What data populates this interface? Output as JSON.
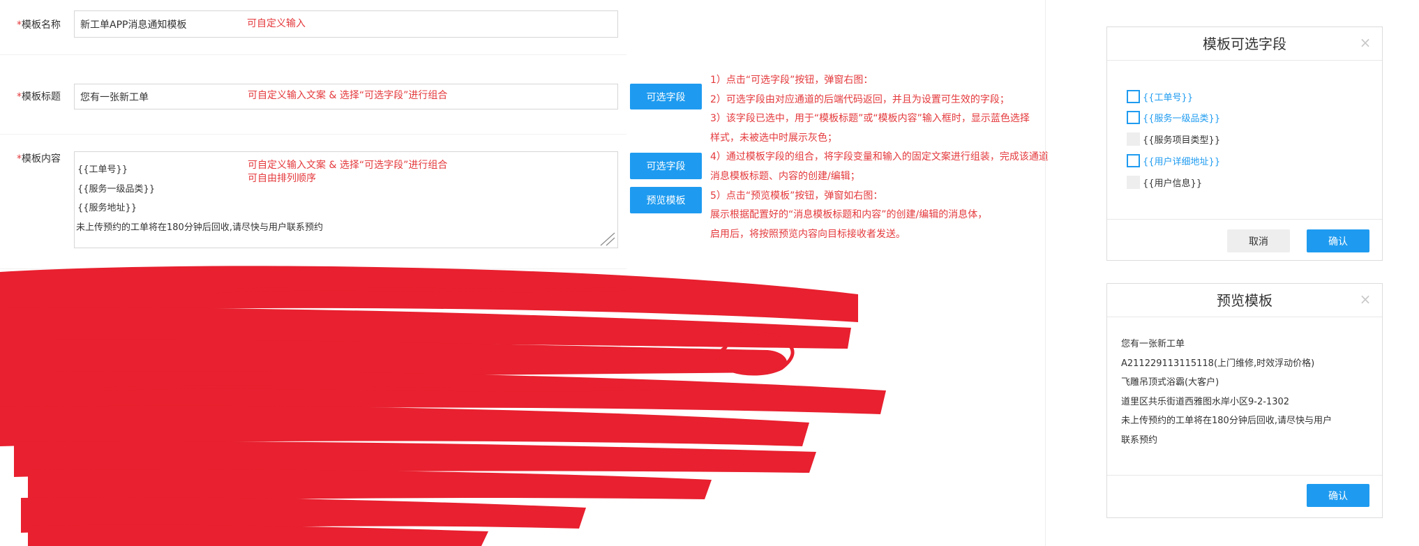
{
  "form": {
    "name": {
      "star": "*",
      "label": "模板名称",
      "value": "新工单APP消息通知模板",
      "note": "可自定义输入"
    },
    "title": {
      "star": "*",
      "label": "模板标题",
      "value": "您有一张新工单",
      "note": "可自定义输入文案 & 选择“可选字段”进行组合",
      "button": "可选字段"
    },
    "content": {
      "star": "*",
      "label": "模板内容",
      "lines": [
        "{{工单号}}",
        "{{服务一级品类}}",
        "{{服务地址}}",
        "未上传预约的工单将在180分钟后回收,请尽快与用户联系预约"
      ],
      "note_lines": [
        "可自定义输入文案 & 选择“可选字段”进行组合",
        "可自由排列顺序"
      ],
      "button": "可选字段",
      "preview_button": "预览模板"
    }
  },
  "notes": [
    "1）点击“可选字段”按钮，弹窗右图：",
    "2）可选字段由对应通道的后端代码返回，并且为设置可生效的字段；",
    "3）该字段已选中，用于“模板标题”或“模板内容”输入框时，显示蓝色选择",
    "样式，未被选中时展示灰色；",
    "4）通过模板字段的组合，将字段变量和输入的固定文案进行组装，完成该通道",
    "消息模板标题、内容的创建/编辑；",
    "5）点击“预览模板”按钮，弹窗如右图：",
    "展示根据配置好的“消息模板标题和内容”的创建/编辑的消息体，",
    "启用后，将按照预览内容向目标接收者发送。"
  ],
  "fields_dialog": {
    "title": "模板可选字段",
    "close": "×",
    "items": [
      {
        "label": "{{工单号}}",
        "checked": true
      },
      {
        "label": "{{服务一级品类}}",
        "checked": true
      },
      {
        "label": "{{服务项目类型}}",
        "checked": false
      },
      {
        "label": "{{用户详细地址}}",
        "checked": true
      },
      {
        "label": "{{用户信息}}",
        "checked": false
      }
    ],
    "cancel": "取消",
    "confirm": "确认"
  },
  "preview_dialog": {
    "title": "预览模板",
    "close": "×",
    "lines": [
      "您有一张新工单",
      "A211229113115118(上门维修,时效浮动价格)",
      "飞雕吊顶式浴霸(大客户)",
      "道里区共乐街道西雅图水岸小区9-2-1302",
      "未上传预约的工单将在180分钟后回收,请尽快与用户",
      "联系预约"
    ],
    "confirm": "确认"
  },
  "colors": {
    "accent": "#1e9bf0",
    "annotation": "#e4393c",
    "scribble": "#e8202f"
  }
}
